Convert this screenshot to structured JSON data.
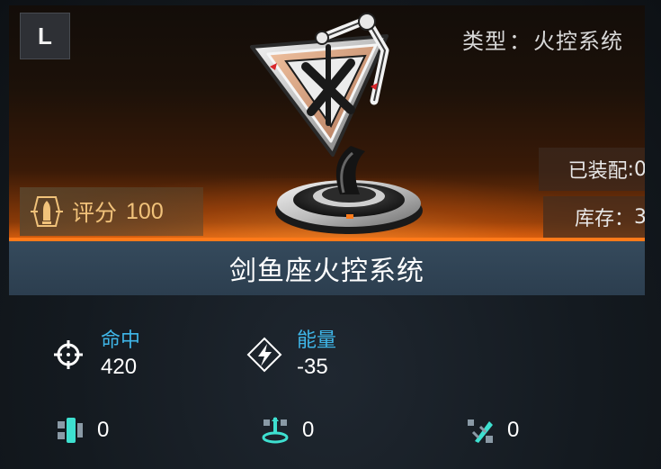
{
  "item": {
    "grade": "L",
    "type_label": "类型",
    "type_value": "火控系统",
    "equipped_label": "已装配",
    "equipped_value": "0",
    "stock_label": "库存",
    "stock_value": "3",
    "score_label": "评分",
    "score_value": "100",
    "name": "剑鱼座火控系统"
  },
  "stats": {
    "hit": {
      "label": "命中",
      "value": "420",
      "icon": "crosshair-icon"
    },
    "energy": {
      "label": "能量",
      "value": "-35",
      "icon": "lightning-icon"
    }
  },
  "minor_stats": [
    {
      "icon": "shield-module-icon",
      "value": "0"
    },
    {
      "icon": "anchor-module-icon",
      "value": "0"
    },
    {
      "icon": "missile-module-icon",
      "value": "0"
    }
  ],
  "colors": {
    "accent_orange": "#ff7a1a",
    "stat_label_blue": "#3fb6e8",
    "score_gold": "#f1c27a",
    "name_bar": "#2f4252"
  }
}
